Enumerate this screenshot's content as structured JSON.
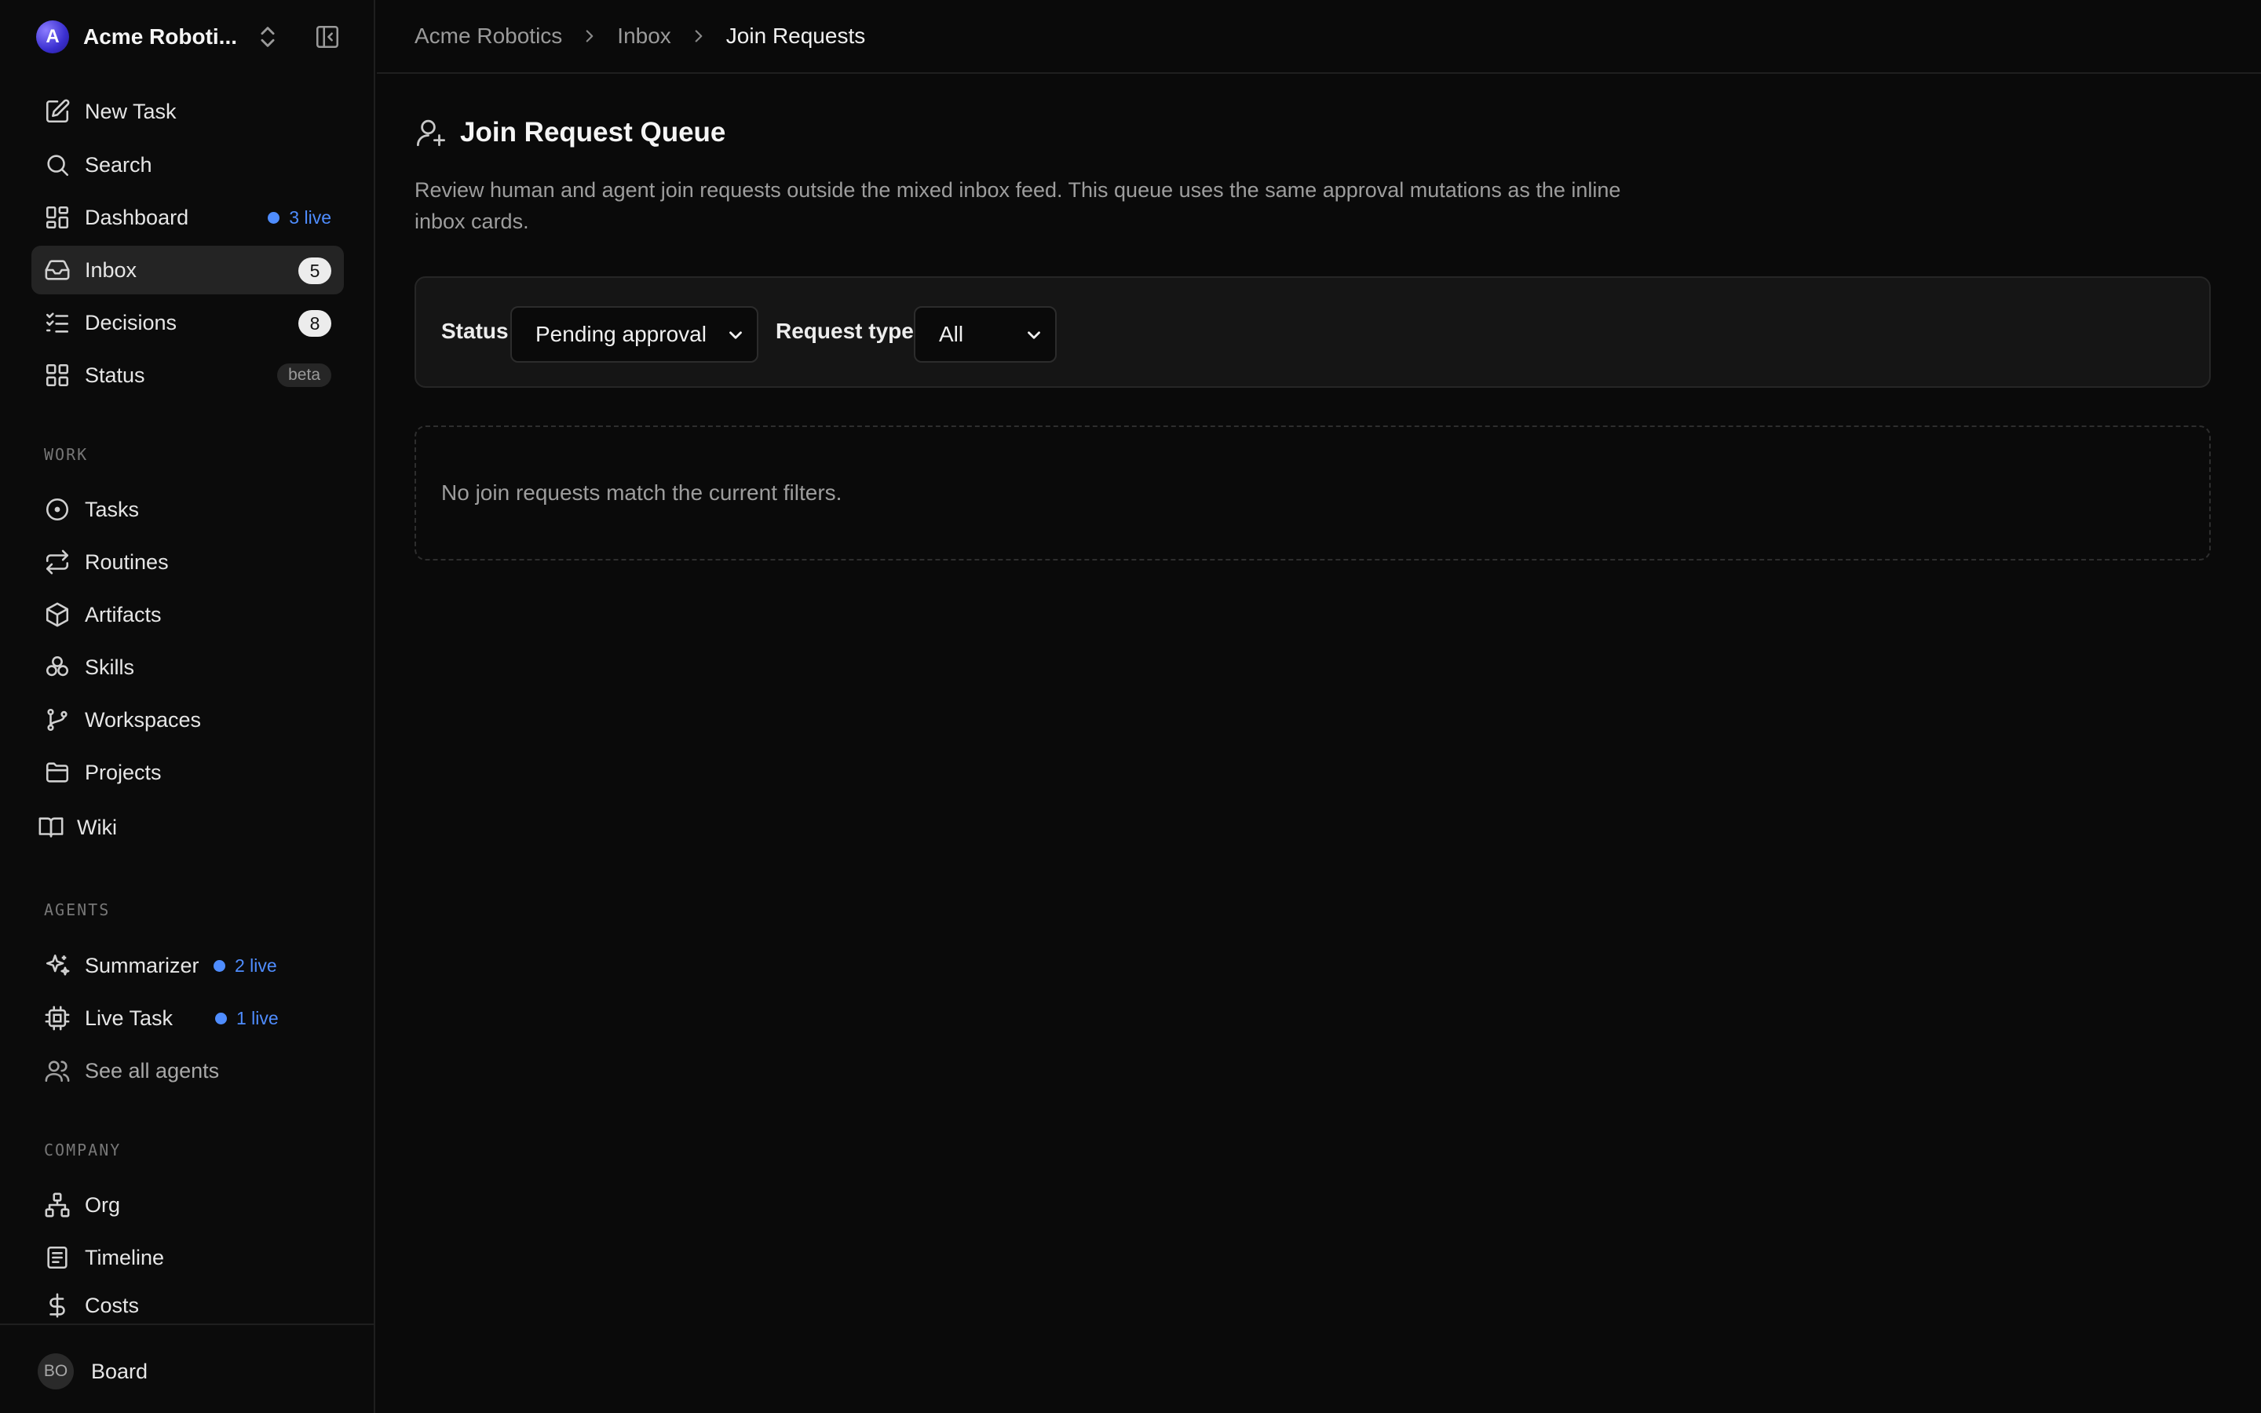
{
  "workspace": {
    "avatar_letter": "A",
    "name": "Acme Roboti..."
  },
  "nav": {
    "primary": [
      {
        "label": "New Task",
        "icon": "new-task-icon"
      },
      {
        "label": "Search",
        "icon": "search-icon"
      },
      {
        "label": "Dashboard",
        "icon": "dashboard-icon",
        "live": "3 live"
      },
      {
        "label": "Inbox",
        "icon": "inbox-icon",
        "count": "5",
        "active": true
      },
      {
        "label": "Decisions",
        "icon": "decisions-icon",
        "count": "8"
      },
      {
        "label": "Status",
        "icon": "status-icon",
        "badge": "beta"
      }
    ],
    "work_label": "WORK",
    "work": [
      {
        "label": "Tasks",
        "icon": "tasks-icon"
      },
      {
        "label": "Routines",
        "icon": "routines-icon"
      },
      {
        "label": "Artifacts",
        "icon": "artifacts-icon"
      },
      {
        "label": "Skills",
        "icon": "skills-icon"
      },
      {
        "label": "Workspaces",
        "icon": "workspaces-icon"
      },
      {
        "label": "Projects",
        "icon": "projects-icon"
      },
      {
        "label": "Wiki",
        "icon": "wiki-icon"
      }
    ],
    "agents_label": "AGENTS",
    "agents": [
      {
        "label": "Summarizer",
        "icon": "sparkles-icon",
        "live": "2 live"
      },
      {
        "label": "Live Task",
        "icon": "cpu-icon",
        "live": "1 live"
      },
      {
        "label": "See all agents",
        "icon": "users-icon"
      }
    ],
    "company_label": "COMPANY",
    "company": [
      {
        "label": "Org",
        "icon": "org-icon"
      },
      {
        "label": "Timeline",
        "icon": "timeline-icon"
      },
      {
        "label": "Costs",
        "icon": "dollar-icon"
      }
    ]
  },
  "user": {
    "initials": "BO",
    "name": "Board"
  },
  "breadcrumb": [
    "Acme Robotics",
    "Inbox",
    "Join Requests"
  ],
  "page": {
    "title": "Join Request Queue",
    "description": "Review human and agent join requests outside the mixed inbox feed. This queue uses the same approval mutations as the inline inbox cards."
  },
  "filters": {
    "status_label": "Status",
    "status_value": "Pending approval",
    "type_label": "Request type",
    "type_value": "All"
  },
  "empty_state": "No join requests match the current filters.",
  "colors": {
    "background": "#0a0a0a",
    "accent_live": "#4f8dff",
    "active_item": "#242424"
  }
}
